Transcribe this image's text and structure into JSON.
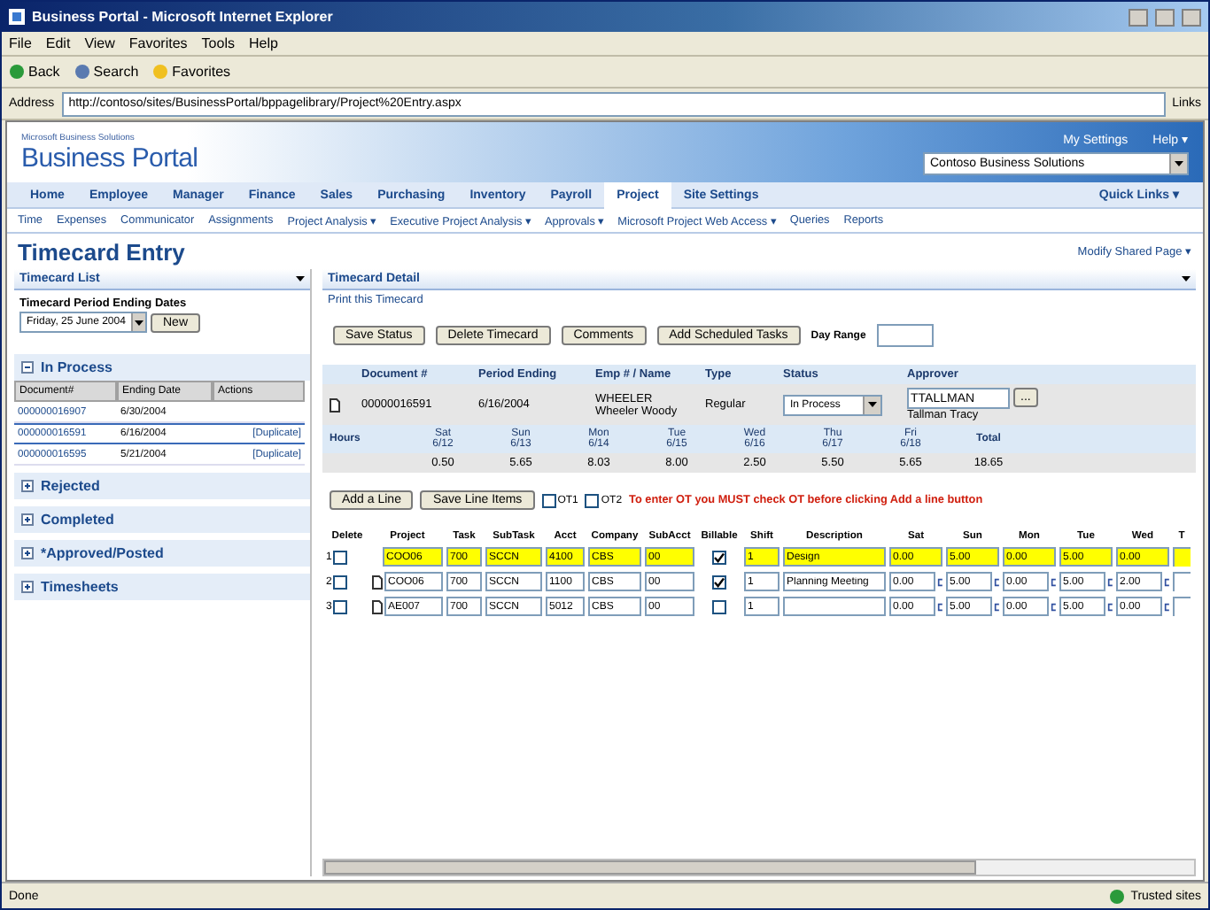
{
  "window": {
    "title": "Business Portal - Microsoft Internet Explorer"
  },
  "menu": [
    "File",
    "Edit",
    "View",
    "Favorites",
    "Tools",
    "Help"
  ],
  "toolbar": [
    "Back",
    "Search",
    "Favorites"
  ],
  "address": {
    "label": "Address",
    "value": "http://contoso/sites/BusinessPortal/bppagelibrary/Project%20Entry.aspx",
    "links": "Links"
  },
  "portal": {
    "brand_small": "Microsoft Business Solutions",
    "brand": "Business Portal",
    "links": [
      "My Settings",
      "Help ▾"
    ],
    "company": "Contoso Business Solutions"
  },
  "nav": {
    "tabs": [
      {
        "label": "Home",
        "selected": false
      },
      {
        "label": "Employee",
        "selected": false
      },
      {
        "label": "Manager",
        "selected": false
      },
      {
        "label": "Finance",
        "selected": false
      },
      {
        "label": "Sales",
        "selected": false
      },
      {
        "label": "Purchasing",
        "selected": false
      },
      {
        "label": "Inventory",
        "selected": false
      },
      {
        "label": "Payroll",
        "selected": false
      },
      {
        "label": "Project",
        "selected": true
      },
      {
        "label": "Site Settings",
        "selected": false
      }
    ],
    "quick_links": "Quick Links ▾"
  },
  "subnav": [
    "Time",
    "Expenses",
    "Communicator",
    "Assignments",
    "Project Analysis ▾",
    "Executive Project Analysis ▾",
    "Approvals ▾",
    "Microsoft Project Web Access ▾",
    "Queries",
    "Reports"
  ],
  "page": {
    "title": "Timecard Entry",
    "modify": "Modify Shared Page ▾"
  },
  "timecard_list": {
    "title": "Timecard List",
    "period_label": "Timecard Period Ending Dates",
    "period_value": "Friday, 25 June 2004",
    "new_button": "New",
    "groups": [
      {
        "label": "In Process",
        "expanded": true,
        "columns": [
          "Document#",
          "Ending Date",
          "Actions"
        ],
        "rows": [
          {
            "document": "000000016907",
            "ending": "6/30/2004",
            "selected": false
          },
          {
            "document": "000000016591",
            "ending": "6/16/2004",
            "action": "[Duplicate]",
            "selected": true
          },
          {
            "document": "000000016595",
            "ending": "5/21/2004",
            "action": "[Duplicate]",
            "selected": false
          }
        ]
      },
      {
        "label": "Rejected",
        "expanded": false
      },
      {
        "label": "Completed",
        "expanded": false
      },
      {
        "label": "*Approved/Posted",
        "expanded": false
      },
      {
        "label": "Timesheets",
        "expanded": false
      }
    ]
  },
  "timecard_detail": {
    "title": "Timecard Detail",
    "print_link": "Print this Timecard",
    "buttons": [
      "Save Status",
      "Delete Timecard",
      "Comments",
      "Add Scheduled Tasks"
    ],
    "day_range_label": "Day Range",
    "header": {
      "columns": [
        "Document #",
        "Period Ending",
        "Emp # / Name",
        "Type",
        "Status",
        "Approver"
      ],
      "document": "00000016591",
      "period_ending": "6/16/2004",
      "emp_id": "WHEELER",
      "emp_name": "Wheeler Woody",
      "type": "Regular",
      "status": "In Process",
      "approver_id": "TTALLMAN",
      "approver_name": "Tallman Tracy",
      "lookup_button": "..."
    },
    "hours": {
      "label": "Hours",
      "days": [
        {
          "day": "Sat",
          "date": "6/12",
          "value": "0.50"
        },
        {
          "day": "Sun",
          "date": "6/13",
          "value": "5.65"
        },
        {
          "day": "Mon",
          "date": "6/14",
          "value": "8.03"
        },
        {
          "day": "Tue",
          "date": "6/15",
          "value": "8.00"
        },
        {
          "day": "Wed",
          "date": "6/16",
          "value": "2.50"
        },
        {
          "day": "Thu",
          "date": "6/17",
          "value": "5.50"
        },
        {
          "day": "Fri",
          "date": "6/18",
          "value": "5.65"
        }
      ],
      "total_label": "Total",
      "total": "18.65"
    },
    "line_buttons": [
      "Add a Line",
      "Save Line Items"
    ],
    "ot": [
      {
        "label": "OT1",
        "checked": false
      },
      {
        "label": "OT2",
        "checked": false
      }
    ],
    "warning": "To enter OT you **MUST** check OT before clicking Add a line button",
    "lines": {
      "columns": [
        "Delete",
        "Project",
        "Task",
        "SubTask",
        "Acct",
        "Company",
        "SubAcct",
        "Billable",
        "Shift",
        "Description",
        "Sat",
        "Sun",
        "Mon",
        "Tue",
        "Wed",
        "T"
      ],
      "rows": [
        {
          "number": "1",
          "delete": false,
          "highlighted": true,
          "note_icon": false,
          "project": "COO06",
          "task": "700",
          "subtask": "SCCN",
          "acct": "4100",
          "company": "CBS",
          "subacct": "00",
          "billable": true,
          "shift": "1",
          "description": "Design",
          "hours": [
            "0.00",
            "5.00",
            "0.00",
            "5.00",
            "0.00"
          ]
        },
        {
          "number": "2",
          "delete": false,
          "highlighted": false,
          "note_icon": true,
          "project": "COO06",
          "task": "700",
          "subtask": "SCCN",
          "acct": "1100",
          "company": "CBS",
          "subacct": "00",
          "billable": true,
          "shift": "1",
          "description": "Planning Meeting",
          "hours": [
            "0.00",
            "5.00",
            "0.00",
            "5.00",
            "2.00"
          ]
        },
        {
          "number": "3",
          "delete": false,
          "highlighted": false,
          "note_icon": true,
          "project": "AE007",
          "task": "700",
          "subtask": "SCCN",
          "acct": "5012",
          "company": "CBS",
          "subacct": "00",
          "billable": false,
          "shift": "1",
          "hours": [
            "0.00",
            "5.00",
            "0.00",
            "5.00",
            "0.00"
          ]
        }
      ]
    }
  },
  "status_bar": {
    "text": "Done",
    "zone": "Trusted sites"
  }
}
